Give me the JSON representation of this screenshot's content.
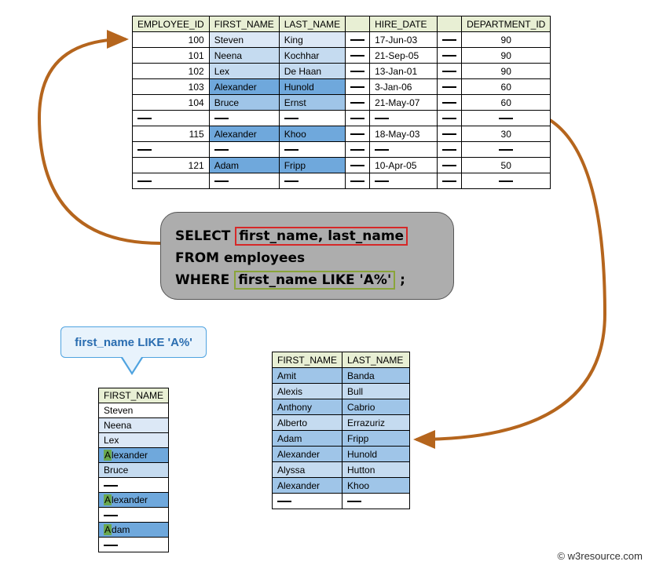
{
  "main_table": {
    "headers": [
      "EMPLOYEE_ID",
      "FIRST_NAME",
      "LAST_NAME",
      "",
      "HIRE_DATE",
      "",
      "DEPARTMENT_ID"
    ],
    "rows": [
      {
        "id": "100",
        "fn": "Steven",
        "ln": "King",
        "hire": "17-Jun-03",
        "dept": "90",
        "shade": "shade1"
      },
      {
        "id": "101",
        "fn": "Neena",
        "ln": "Kochhar",
        "hire": "21-Sep-05",
        "dept": "90",
        "shade": "shade2"
      },
      {
        "id": "102",
        "fn": "Lex",
        "ln": "De Haan",
        "hire": "13-Jan-01",
        "dept": "90",
        "shade": "shade2"
      },
      {
        "id": "103",
        "fn": "Alexander",
        "ln": "Hunold",
        "hire": "3-Jan-06",
        "dept": "60",
        "shade": "shade4"
      },
      {
        "id": "104",
        "fn": "Bruce",
        "ln": "Ernst",
        "hire": "21-May-07",
        "dept": "60",
        "shade": "shade3"
      },
      {
        "gap": true
      },
      {
        "id": "115",
        "fn": "Alexander",
        "ln": "Khoo",
        "hire": "18-May-03",
        "dept": "30",
        "shade": "shade4"
      },
      {
        "gap": true
      },
      {
        "id": "121",
        "fn": "Adam",
        "ln": "Fripp",
        "hire": "10-Apr-05",
        "dept": "50",
        "shade": "shade4"
      },
      {
        "gap": true
      }
    ]
  },
  "sql": {
    "select_kw": "SELECT",
    "select_cols": "first_name, last_name",
    "from_line": "FROM employees",
    "where_kw": "WHERE",
    "where_cond": "first_name LIKE 'A%'",
    "terminator": " ;"
  },
  "result_table": {
    "headers": [
      "FIRST_NAME",
      "LAST_NAME"
    ],
    "rows": [
      {
        "fn": "Amit",
        "ln": "Banda",
        "cls": "r1"
      },
      {
        "fn": "Alexis",
        "ln": "Bull",
        "cls": "r2"
      },
      {
        "fn": "Anthony",
        "ln": "Cabrio",
        "cls": "r1"
      },
      {
        "fn": "Alberto",
        "ln": "Errazuriz",
        "cls": "r2"
      },
      {
        "fn": "Adam",
        "ln": "Fripp",
        "cls": "r1"
      },
      {
        "fn": "Alexander",
        "ln": "Hunold",
        "cls": "r1"
      },
      {
        "fn": "Alyssa",
        "ln": "Hutton",
        "cls": "r2"
      },
      {
        "fn": "Alexander",
        "ln": "Khoo",
        "cls": "r1"
      },
      {
        "gap": true
      }
    ]
  },
  "callout_label": "first_name LIKE 'A%'",
  "fn_table": {
    "header": "FIRST_NAME",
    "rows": [
      {
        "text": "Steven",
        "cls": ""
      },
      {
        "text": "Neena",
        "cls": "s1"
      },
      {
        "text": "Lex",
        "cls": "s1"
      },
      {
        "text": "Alexander",
        "cls": "s4",
        "hlA": true
      },
      {
        "text": "Bruce",
        "cls": "s2"
      },
      {
        "gap": true
      },
      {
        "text": "Alexander",
        "cls": "s4",
        "hlA": true
      },
      {
        "gap": true
      },
      {
        "text": "Adam",
        "cls": "s4",
        "hlA": true
      },
      {
        "gap": true
      }
    ]
  },
  "copyright": "© w3resource.com"
}
